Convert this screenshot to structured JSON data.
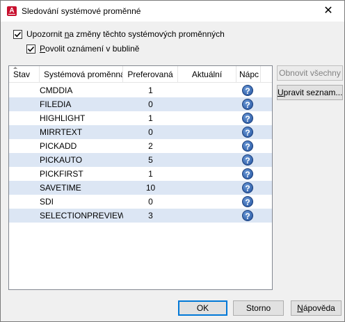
{
  "window": {
    "title": "Sledování systémové proměnné",
    "close_glyph": "✕",
    "app_icon_letter": "A"
  },
  "options": {
    "notify_label_pre": "Upozornit ",
    "notify_label_u": "n",
    "notify_label_post": "a změny těchto systémových proměnných",
    "notify_checked": true,
    "balloon_label_u": "P",
    "balloon_label_post": "ovolit oznámení v bublině",
    "balloon_checked": true
  },
  "table": {
    "columns": [
      "Stav",
      "Systémová proměnná",
      "Preferovaná",
      "Aktuální",
      "Nápc"
    ],
    "rows": [
      {
        "name": "CMDDIA",
        "preferred": "1",
        "current": "",
        "help": "?"
      },
      {
        "name": "FILEDIA",
        "preferred": "0",
        "current": "",
        "help": "?"
      },
      {
        "name": "HIGHLIGHT",
        "preferred": "1",
        "current": "",
        "help": "?"
      },
      {
        "name": "MIRRTEXT",
        "preferred": "0",
        "current": "",
        "help": "?"
      },
      {
        "name": "PICKADD",
        "preferred": "2",
        "current": "",
        "help": "?"
      },
      {
        "name": "PICKAUTO",
        "preferred": "5",
        "current": "",
        "help": "?"
      },
      {
        "name": "PICKFIRST",
        "preferred": "1",
        "current": "",
        "help": "?"
      },
      {
        "name": "SAVETIME",
        "preferred": "10",
        "current": "",
        "help": "?"
      },
      {
        "name": "SDI",
        "preferred": "0",
        "current": "",
        "help": "?"
      },
      {
        "name": "SELECTIONPREVIEW",
        "preferred": "3",
        "current": "",
        "help": "?"
      }
    ]
  },
  "side_buttons": {
    "restore_all": "Obnovit všechny",
    "edit_list_u": "U",
    "edit_list_post": "pravit seznam..."
  },
  "footer": {
    "ok": "OK",
    "cancel": "Storno",
    "help_u": "N",
    "help_post": "ápověda"
  },
  "colors": {
    "alt_row": "#dce6f4",
    "help_icon": "#1f4f9c",
    "default_button_border": "#0078d7",
    "app_icon": "#c8102e"
  }
}
